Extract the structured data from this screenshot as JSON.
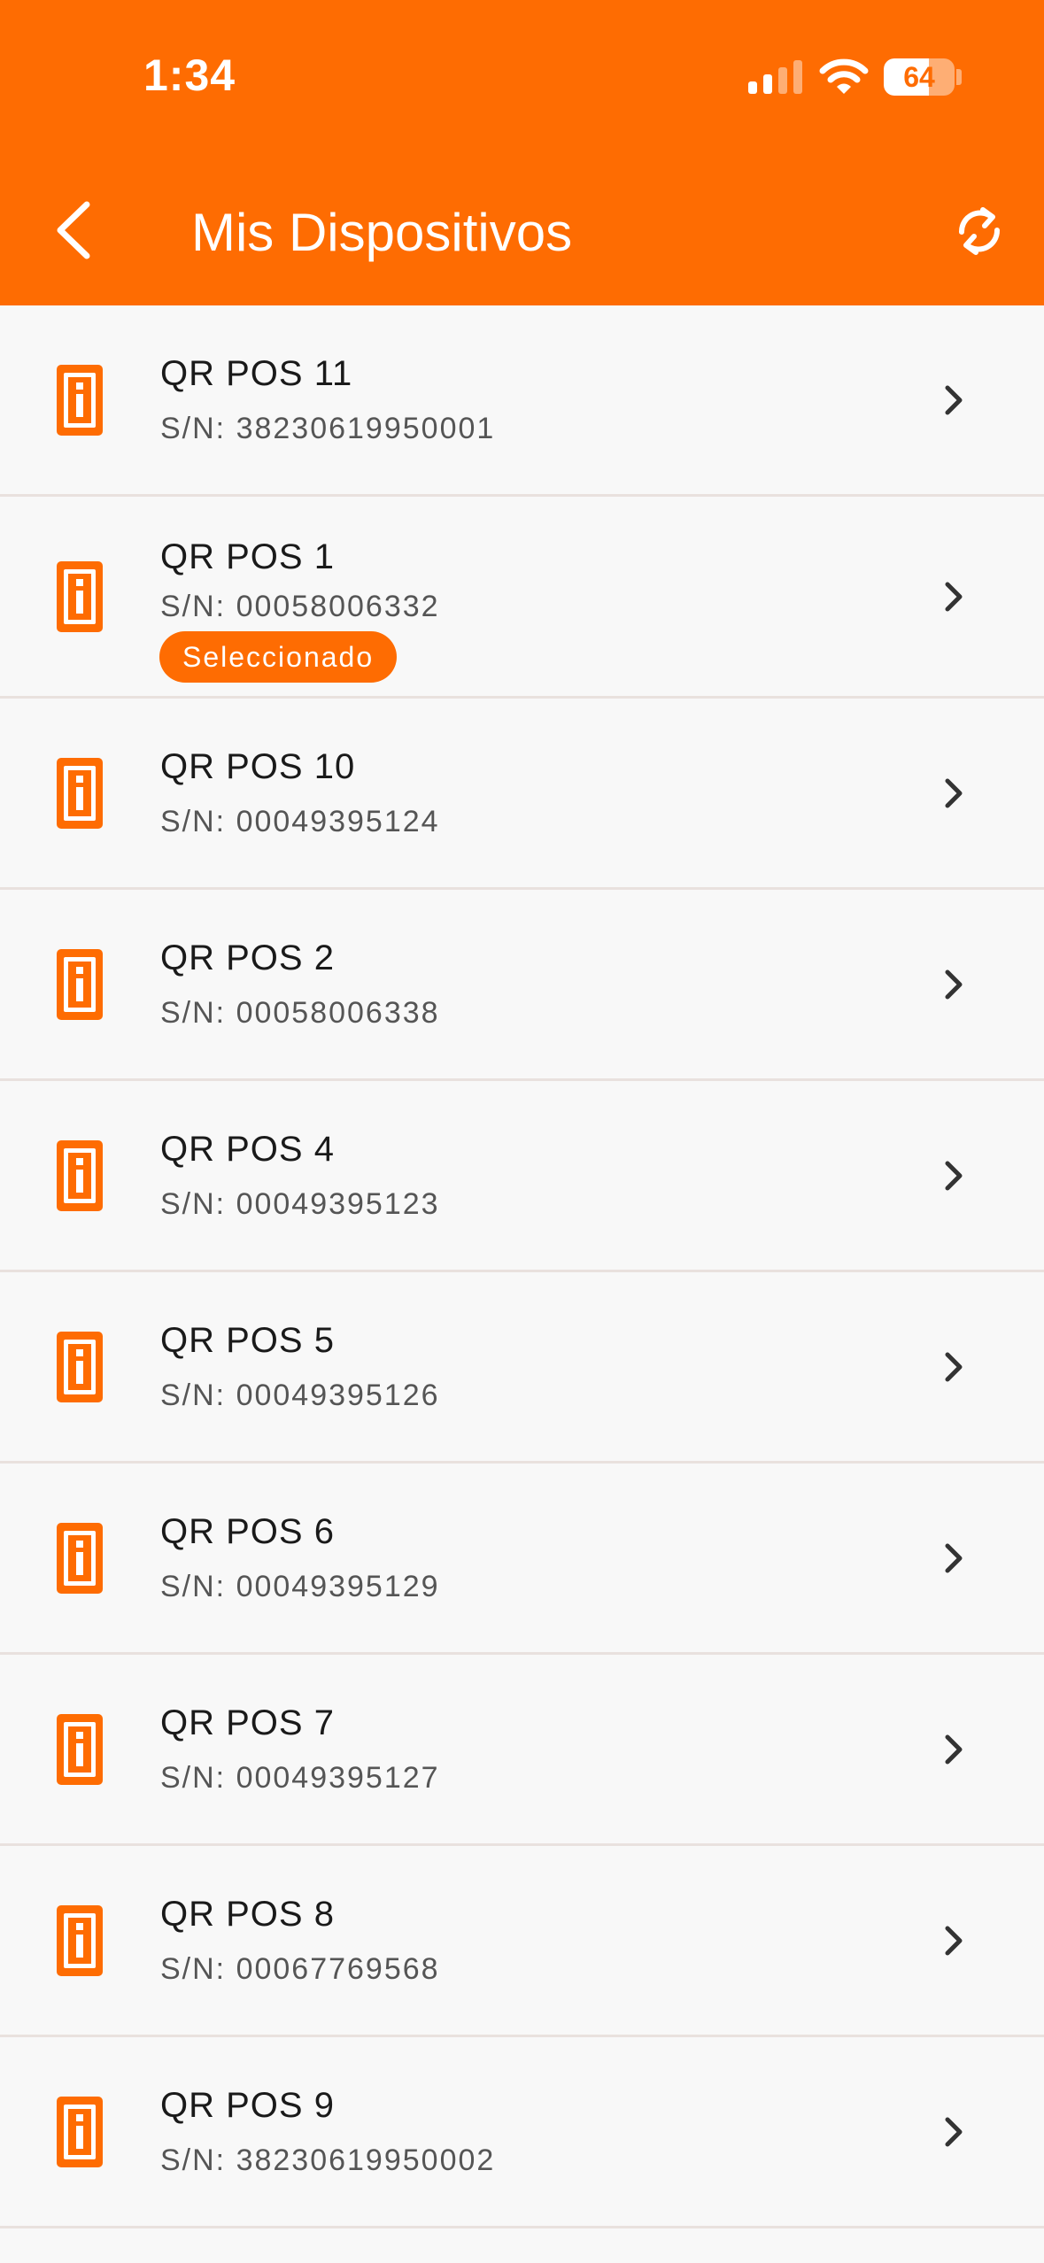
{
  "status_bar": {
    "time": "1:34",
    "battery": "64",
    "battery_level": 0.64
  },
  "header": {
    "title": "Mis Dispositivos"
  },
  "colors": {
    "accent": "#fe6c02",
    "background": "#f8f8f8",
    "divider": "#e9e1de"
  },
  "icons": {
    "back": "chevron-left-icon",
    "refresh": "refresh-icon",
    "device": "pos-terminal-icon",
    "row_arrow": "chevron-right-icon"
  },
  "devices": [
    {
      "name": "QR POS 11",
      "serial": "S/N: 38230619950001",
      "badge": ""
    },
    {
      "name": "QR POS 1",
      "serial": "S/N: 00058006332",
      "badge": "Seleccionado"
    },
    {
      "name": "QR POS 10",
      "serial": "S/N: 00049395124",
      "badge": ""
    },
    {
      "name": "QR POS 2",
      "serial": "S/N: 00058006338",
      "badge": ""
    },
    {
      "name": "QR POS 4",
      "serial": "S/N: 00049395123",
      "badge": ""
    },
    {
      "name": "QR POS 5",
      "serial": "S/N: 00049395126",
      "badge": ""
    },
    {
      "name": "QR POS 6",
      "serial": "S/N: 00049395129",
      "badge": ""
    },
    {
      "name": "QR POS 7",
      "serial": "S/N: 00049395127",
      "badge": ""
    },
    {
      "name": "QR POS 8",
      "serial": "S/N: 00067769568",
      "badge": ""
    },
    {
      "name": "QR POS 9",
      "serial": "S/N: 38230619950002",
      "badge": ""
    }
  ]
}
